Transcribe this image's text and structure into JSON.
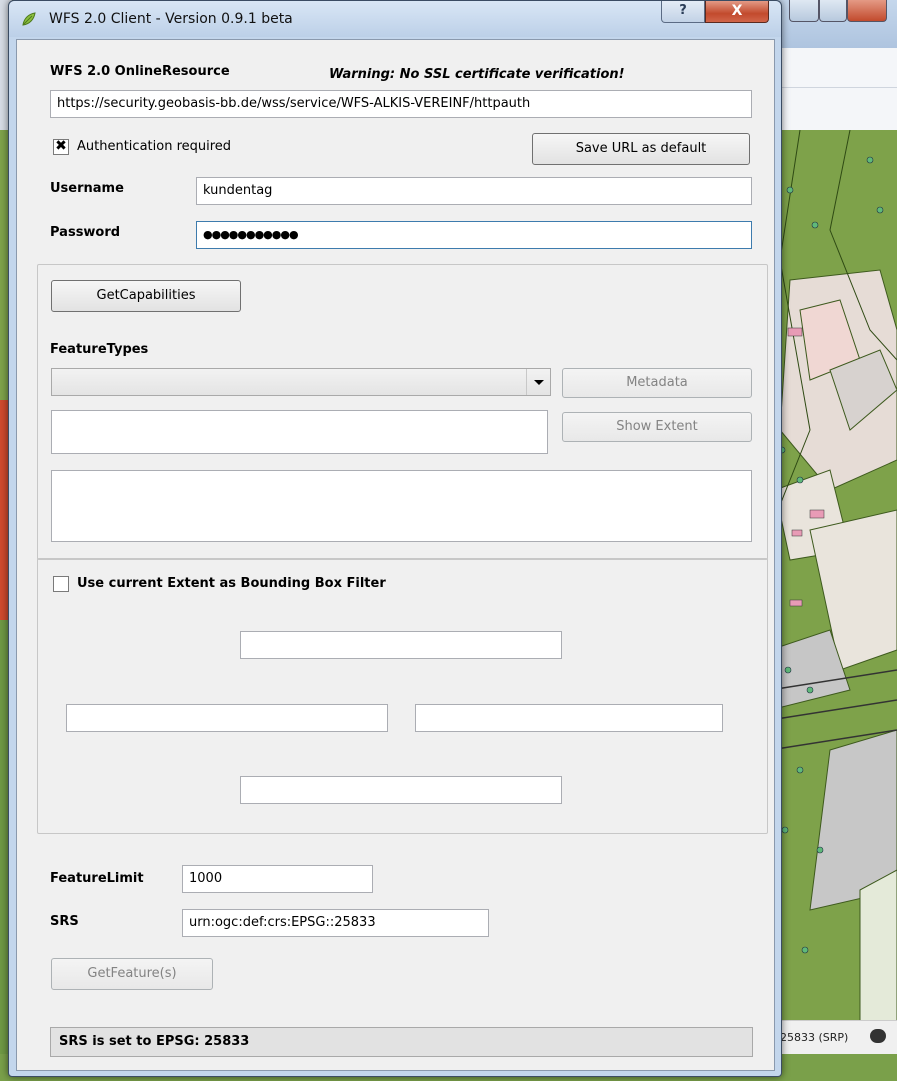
{
  "window": {
    "title": "WFS 2.0 Client - Version 0.9.1 beta",
    "help_glyph": "?",
    "close_glyph": "X"
  },
  "online_resource": {
    "label": "WFS 2.0 OnlineResource",
    "warning": "Warning: No SSL certificate verification!",
    "url": "https://security.geobasis-bb.de/wss/service/WFS-ALKIS-VEREINF/httpauth"
  },
  "auth": {
    "checkbox_label": "Authentication required",
    "checked": true,
    "check_glyph": "✖",
    "save_url_button": "Save URL as default",
    "username_label": "Username",
    "username_value": "kundentag",
    "password_label": "Password",
    "password_value": "●●●●●●●●●●●"
  },
  "capabilities": {
    "get_capabilities_button": "GetCapabilities",
    "feature_types_label": "FeatureTypes",
    "feature_type_selected": "",
    "metadata_button": "Metadata",
    "show_extent_button": "Show Extent"
  },
  "bbox": {
    "checkbox_label": "Use current Extent as Bounding Box Filter",
    "checked": false
  },
  "feature": {
    "feature_limit_label": "FeatureLimit",
    "feature_limit_value": "1000",
    "srs_label": "SRS",
    "srs_value": "urn:ogc:def:crs:EPSG::25833",
    "get_feature_button": "GetFeature(s)",
    "status_text": "SRS is set to EPSG: 25833"
  },
  "background_app": {
    "statusbar_text": "25833 (SRP)",
    "colors": {
      "map_green": "#7ea24a",
      "map_dark_green": "#5b7a2e",
      "road": "#e9e4dc",
      "building": "#d9c7c7",
      "pink": "#e89bb6"
    }
  }
}
